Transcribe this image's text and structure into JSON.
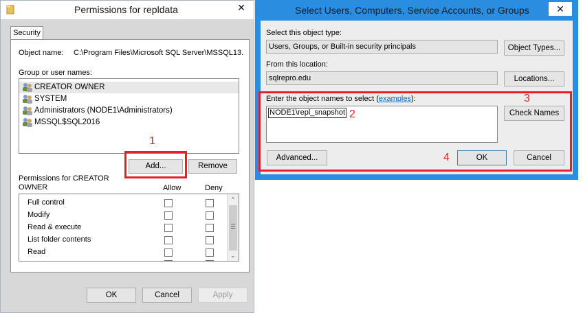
{
  "permissions_dialog": {
    "title": "Permissions for repldata",
    "close_label": "✕",
    "tab_security": "Security",
    "object_name_label": "Object name:",
    "object_name_value": "C:\\Program Files\\Microsoft SQL Server\\MSSQL13.",
    "group_label": "Group or user names:",
    "users": [
      "CREATOR OWNER",
      "SYSTEM",
      "Administrators (NODE1\\Administrators)",
      "MSSQL$SQL2016"
    ],
    "add_button": "Add...",
    "remove_button": "Remove",
    "permissions_for_label": "Permissions for CREATOR\nOWNER",
    "allow_header": "Allow",
    "deny_header": "Deny",
    "permissions": [
      "Full control",
      "Modify",
      "Read & execute",
      "List folder contents",
      "Read"
    ],
    "ok_button": "OK",
    "cancel_button": "Cancel",
    "apply_button": "Apply"
  },
  "select_dialog": {
    "title": "Select Users, Computers, Service Accounts, or Groups",
    "close_label": "✕",
    "object_type_label": "Select this object type:",
    "object_type_value": "Users, Groups, or Built-in security principals",
    "object_types_button": "Object Types...",
    "location_label": "From this location:",
    "location_value": "sqlrepro.edu",
    "locations_button": "Locations...",
    "enter_label_pre": "Enter the object names to select (",
    "examples_link": "examples",
    "enter_label_post": "):",
    "object_names_value": "NODE1\\repl_snapshot",
    "check_names_button": "Check Names",
    "advanced_button": "Advanced...",
    "ok_button": "OK",
    "cancel_button": "Cancel"
  },
  "annotations": {
    "step1": "1",
    "step2": "2",
    "step3": "3",
    "step4": "4",
    "color": "#e6202b"
  }
}
